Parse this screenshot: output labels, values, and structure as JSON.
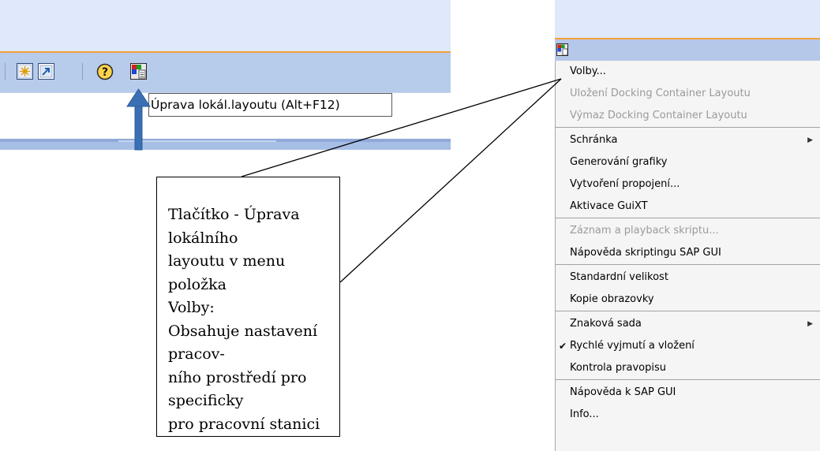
{
  "tooltip": "Úprava lokál.layoutu (Alt+F12)",
  "callout": {
    "text": "Tlačítko - Úprava lokálního\nlayoutu  v menu položka\nVolby:\nObsahuje nastavení pracov-\nního prostředí pro specificky\npro pracovní stanici"
  },
  "toolbar": {
    "icons": [
      "layout-icon",
      "shortcut-icon",
      "help-icon",
      "customize-local-layout-icon"
    ]
  },
  "menu": {
    "title_icon": "customize-local-layout-icon",
    "items": [
      {
        "label": "Volby...",
        "enabled": true
      },
      {
        "label": "Uložení Docking Container Layoutu",
        "enabled": false
      },
      {
        "label": "Výmaz Docking Container Layoutu",
        "enabled": false
      },
      {
        "label": "Schránka",
        "enabled": true,
        "submenu": true
      },
      {
        "label": "Generování grafiky",
        "enabled": true
      },
      {
        "label": "Vytvoření propojení...",
        "enabled": true
      },
      {
        "label": "Aktivace GuiXT",
        "enabled": true
      },
      {
        "label": "Záznam a playback skriptu...",
        "enabled": false
      },
      {
        "label": "Nápověda skriptingu SAP GUI",
        "enabled": true
      },
      {
        "label": "Standardní velikost",
        "enabled": true
      },
      {
        "label": "Kopie obrazovky",
        "enabled": true
      },
      {
        "label": "Znaková sada",
        "enabled": true,
        "submenu": true
      },
      {
        "label": "Rychlé vyjmutí a vložení",
        "enabled": true,
        "checked": true
      },
      {
        "label": "Kontrola pravopisu",
        "enabled": true
      },
      {
        "label": "Nápověda k SAP GUI",
        "enabled": true
      },
      {
        "label": "Info...",
        "enabled": true
      }
    ]
  },
  "colors": {
    "header_bg": "#dfe9fb",
    "toolbar_bg": "#b7cbeb",
    "accent_orange": "#f5a13c",
    "arrow_blue": "#3a6fb3"
  }
}
